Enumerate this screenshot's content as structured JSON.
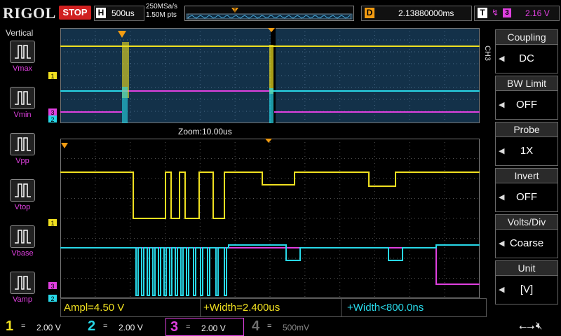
{
  "top": {
    "brand": "RIGOL",
    "run_state": "STOP",
    "h_label": "H",
    "timebase": "500us",
    "sample_rate": "250MSa/s",
    "mem_depth": "1.50M pts",
    "trigger_marker": "T",
    "delay_label": "D",
    "delay": "2.13880000ms",
    "trigger_label": "T",
    "trigger_channel": "3",
    "trigger_level": "2.16 V"
  },
  "left_panel": {
    "title": "Vertical",
    "items": [
      "Vmax",
      "Vmin",
      "Vpp",
      "Vtop",
      "Vbase",
      "Vamp"
    ]
  },
  "screen": {
    "zoom_label": "Zoom:10.00us",
    "overview_markers": [
      "1",
      "3",
      "2"
    ],
    "main_markers": [
      "1",
      "3",
      "2"
    ],
    "trigger_marker": "T",
    "colors": {
      "ch1": "#f0e020",
      "ch2": "#28d8e8",
      "ch3": "#e040e0",
      "ch4": "#707070",
      "overview_bg": "#133149",
      "accent": "#f39c12"
    }
  },
  "measurements": [
    {
      "text": "Ampl=4.50 V"
    },
    {
      "text": "+Width=2.400us"
    },
    {
      "text": "+Width<800.0ns"
    }
  ],
  "right_panel": {
    "channel_tag": "CH3",
    "groups": [
      {
        "header": "Coupling",
        "value": "DC"
      },
      {
        "header": "BW Limit",
        "value": "OFF"
      },
      {
        "header": "Probe",
        "value": "1X"
      },
      {
        "header": "Invert",
        "value": "OFF"
      },
      {
        "header": "Volts/Div",
        "value": "Coarse"
      },
      {
        "header": "Unit",
        "value": "[V]"
      }
    ]
  },
  "bottom": {
    "channels": [
      {
        "num": "1",
        "coupling": "=",
        "scale": "2.00 V",
        "color": "#f0e020"
      },
      {
        "num": "2",
        "coupling": "=",
        "scale": "2.00 V",
        "color": "#28d8e8"
      },
      {
        "num": "3",
        "coupling": "=",
        "scale": "2.00 V",
        "color": "#e040e0"
      },
      {
        "num": "4",
        "coupling": "=",
        "scale": "500mV",
        "color": "#707070"
      }
    ]
  }
}
